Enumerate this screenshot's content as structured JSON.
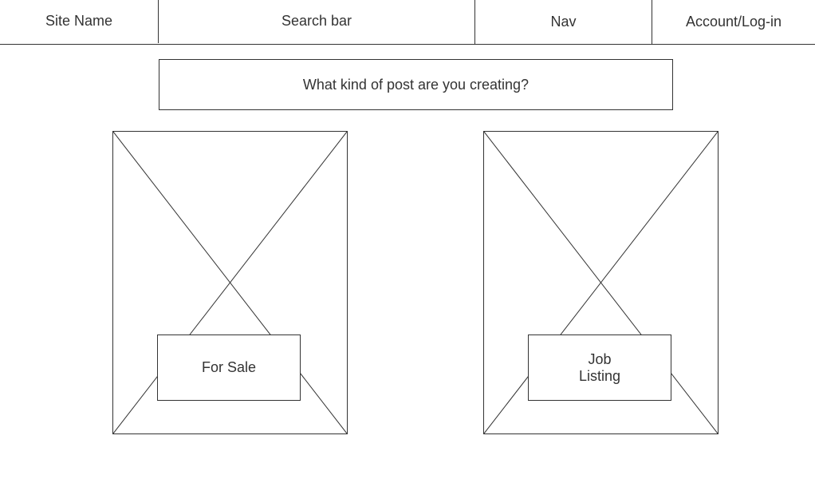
{
  "header": {
    "site_name": "Site Name",
    "search_bar": "Search bar",
    "nav": "Nav",
    "account": "Account/Log-in"
  },
  "main": {
    "prompt": "What kind of post are you creating?",
    "options": [
      {
        "label": "For Sale"
      },
      {
        "label_lines": [
          "Job",
          "Listing"
        ]
      }
    ]
  }
}
